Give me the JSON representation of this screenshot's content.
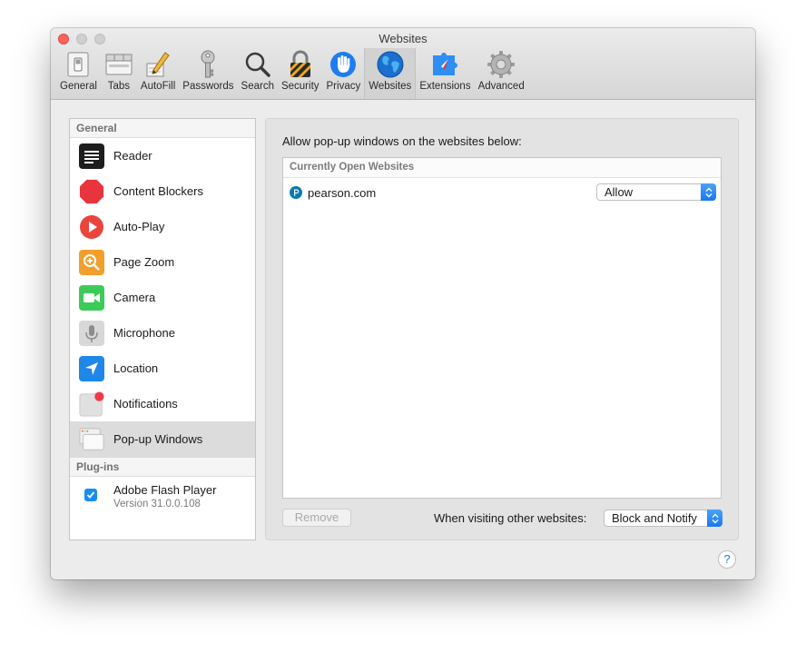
{
  "window": {
    "title": "Websites"
  },
  "toolbar": {
    "items": [
      {
        "label": "General",
        "icon": "general-switch-icon"
      },
      {
        "label": "Tabs",
        "icon": "tabs-icon"
      },
      {
        "label": "AutoFill",
        "icon": "pencil-icon"
      },
      {
        "label": "Passwords",
        "icon": "key-icon"
      },
      {
        "label": "Search",
        "icon": "magnifier-icon"
      },
      {
        "label": "Security",
        "icon": "padlock-icon"
      },
      {
        "label": "Privacy",
        "icon": "hand-icon"
      },
      {
        "label": "Websites",
        "icon": "globe-icon",
        "active": true
      },
      {
        "label": "Extensions",
        "icon": "extensions-icon"
      },
      {
        "label": "Advanced",
        "icon": "gear-icon"
      }
    ]
  },
  "sidebar": {
    "general_header": "General",
    "items": [
      {
        "label": "Reader",
        "icon": "reader-icon"
      },
      {
        "label": "Content Blockers",
        "icon": "stop-sign-icon"
      },
      {
        "label": "Auto-Play",
        "icon": "play-icon"
      },
      {
        "label": "Page Zoom",
        "icon": "zoom-icon"
      },
      {
        "label": "Camera",
        "icon": "camera-icon"
      },
      {
        "label": "Microphone",
        "icon": "microphone-icon"
      },
      {
        "label": "Location",
        "icon": "location-arrow-icon"
      },
      {
        "label": "Notifications",
        "icon": "notifications-icon"
      },
      {
        "label": "Pop-up Windows",
        "icon": "popup-windows-icon",
        "selected": true
      }
    ],
    "plugins_header": "Plug-ins",
    "plugins": [
      {
        "name": "Adobe Flash Player",
        "version": "Version 31.0.0.108",
        "checked": true
      }
    ]
  },
  "panel": {
    "heading": "Allow pop-up windows on the websites below:",
    "table_header": "Currently Open Websites",
    "sites": [
      {
        "domain": "pearson.com",
        "setting": "Allow"
      }
    ],
    "remove_label": "Remove",
    "other_label": "When visiting other websites:",
    "other_setting": "Block and Notify"
  },
  "help": {
    "label": "?"
  },
  "colors": {
    "accent": "#1b8bf4",
    "close_button": "#fc605c",
    "window_bg": "#ececec"
  }
}
